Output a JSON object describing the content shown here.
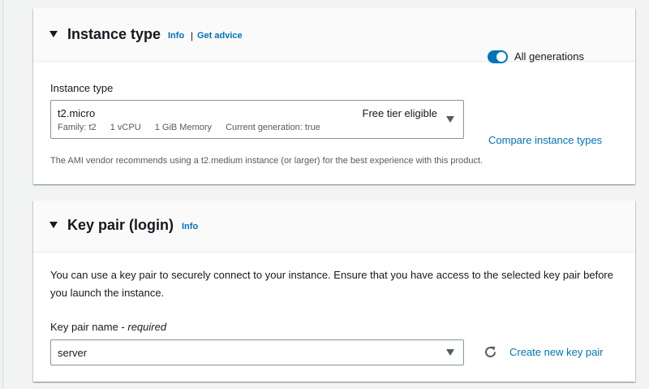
{
  "instance_type": {
    "title": "Instance type",
    "info_link": "Info",
    "separator": "|",
    "advice_link": "Get advice",
    "field_label": "Instance type",
    "selected": {
      "name": "t2.micro",
      "tag": "Free tier eligible",
      "family": "Family: t2",
      "vcpu": "1 vCPU",
      "memory": "1 GiB Memory",
      "generation": "Current generation: true"
    },
    "toggle": {
      "label": "All generations",
      "on": true
    },
    "compare_link": "Compare instance types",
    "help_text": "The AMI vendor recommends using a t2.medium instance (or larger) for the best experience with this product."
  },
  "key_pair": {
    "title": "Key pair (login)",
    "info_link": "Info",
    "description": "You can use a key pair to securely connect to your instance. Ensure that you have access to the selected key pair before you launch the instance.",
    "field_label": "Key pair name - ",
    "field_required": "required",
    "selected": "server",
    "create_link": "Create new key pair"
  },
  "colors": {
    "link": "#0073bb",
    "toggle_on": "#0073bb",
    "text": "#16191f",
    "muted": "#545b64",
    "background": "#f2f3f3"
  },
  "icons": [
    "caret-down-icon",
    "dropdown-arrow-icon",
    "refresh-icon"
  ]
}
